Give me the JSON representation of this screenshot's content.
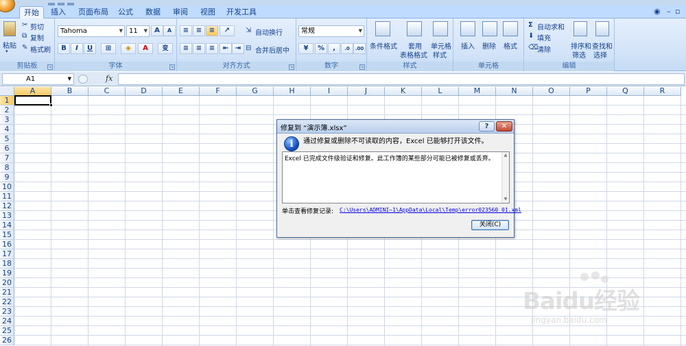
{
  "tabs": [
    "开始",
    "插入",
    "页面布局",
    "公式",
    "数据",
    "审阅",
    "视图",
    "开发工具"
  ],
  "active_tab": "开始",
  "ribbon": {
    "clipboard": {
      "paste": "粘贴",
      "cut": "剪切",
      "copy": "复制",
      "format_painter": "格式刷",
      "label": "剪贴板"
    },
    "font": {
      "name": "Tahoma",
      "size": "11",
      "grow": "A",
      "shrink": "A",
      "bold": "B",
      "italic": "I",
      "underline": "U",
      "color_a": "A",
      "phonetic": "变",
      "label": "字体"
    },
    "alignment": {
      "wrap_text": "自动换行",
      "merge_center": "合并后居中",
      "label": "对齐方式"
    },
    "number": {
      "format": "常规",
      "percent": "%",
      "comma": ",",
      "label": "数字"
    },
    "styles": {
      "conditional": "条件格式",
      "table_format_1": "套用",
      "table_format_2": "表格格式",
      "cell_styles_1": "单元格",
      "cell_styles_2": "样式",
      "label": "样式"
    },
    "cells": {
      "insert": "插入",
      "delete": "删除",
      "format": "格式",
      "label": "单元格"
    },
    "editing": {
      "autosum": "自动求和",
      "fill": "填充",
      "clear": "清除",
      "sort_1": "排序和",
      "sort_2": "筛选",
      "find_1": "查找和",
      "find_2": "选择",
      "label": "编辑"
    }
  },
  "formula_bar": {
    "name_box": "A1",
    "fx": "fx"
  },
  "columns": [
    "A",
    "B",
    "C",
    "D",
    "E",
    "F",
    "G",
    "H",
    "I",
    "J",
    "K",
    "L",
    "M",
    "N",
    "O",
    "P",
    "Q",
    "R"
  ],
  "rows": [
    "1",
    "2",
    "3",
    "4",
    "5",
    "6",
    "7",
    "8",
    "9",
    "10",
    "11",
    "12",
    "13",
    "14",
    "15",
    "16",
    "17",
    "18",
    "19",
    "20",
    "21",
    "22",
    "23",
    "24",
    "25",
    "26"
  ],
  "dialog": {
    "title": "修复到 “演示簿.xlsx”",
    "help": "?",
    "close_x": "✕",
    "message": "通过修复或删除不可读取的内容，Excel 已能够打开该文件。",
    "details": "Excel 已完成文件级验证和修复。此工作簿的某些部分可能已被修复或丢弃。",
    "log_label": "单击查看修复记录:",
    "log_link": "C:\\Users\\ADMINI~1\\AppData\\Local\\Temp\\error023560_01.xml",
    "close_button": "关闭(C)"
  },
  "watermark": {
    "brand": "Baidu经验",
    "url": "jingyan.baidu.com"
  }
}
